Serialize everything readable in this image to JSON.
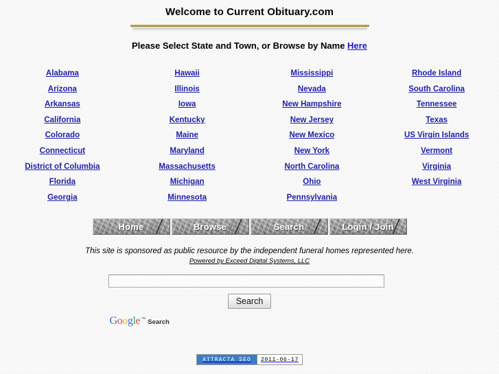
{
  "header": {
    "title": "Welcome to Current Obituary.com",
    "subtitle_prefix": "Please Select State and Town, or Browse by Name ",
    "subtitle_link": "Here",
    "rule_color": "#a89a34"
  },
  "states": {
    "columns": [
      {
        "items": [
          "Alabama",
          "Arizona",
          "Arkansas",
          "California",
          "Colorado",
          "Connecticut",
          "District of Columbia",
          "Florida",
          "Georgia"
        ]
      },
      {
        "items": [
          "Hawaii",
          "Illinois",
          "Iowa",
          "Kentucky",
          "Maine",
          "Maryland",
          "Massachusetts",
          "Michigan",
          "Minnesota"
        ]
      },
      {
        "items": [
          "Mississippi",
          "Nevada",
          "New Hampshire",
          "New Jersey",
          "New Mexico",
          "New York",
          "North Carolina",
          "Ohio",
          "Pennsylvania"
        ]
      },
      {
        "items": [
          "Rhode Island",
          "South Carolina",
          "Tennessee",
          "Texas",
          "US Virgin Islands",
          "Vermont",
          "Virginia",
          "West Virginia"
        ]
      }
    ],
    "link_color": "#1f1fa8"
  },
  "nav": {
    "buttons": [
      {
        "label": "Home",
        "name": "nav-home"
      },
      {
        "label": "Browse",
        "name": "nav-browse"
      },
      {
        "label": "Search",
        "name": "nav-search"
      },
      {
        "label": "Login / Join",
        "name": "nav-login-join"
      }
    ]
  },
  "sponsor": {
    "text": "This site is sponsored as public resource by the independent funeral homes represented here.",
    "powered_by": "Powered by Exceed Digital Systems, LLC"
  },
  "search": {
    "value": "",
    "placeholder": "",
    "button_label": "Search",
    "branding": {
      "letters": [
        {
          "char": "G",
          "color": "#3b6fd4"
        },
        {
          "char": "o",
          "color": "#dd4b39"
        },
        {
          "char": "o",
          "color": "#f0b429"
        },
        {
          "char": "g",
          "color": "#3b6fd4"
        },
        {
          "char": "l",
          "color": "#3aa757"
        },
        {
          "char": "e",
          "color": "#dd4b39"
        }
      ],
      "trademark": "™",
      "word": "Search"
    }
  },
  "footer": {
    "badge_label": "ATTRACTA SEO",
    "badge_date": "2011-06-17",
    "badge_color": "#3b7dc4"
  }
}
